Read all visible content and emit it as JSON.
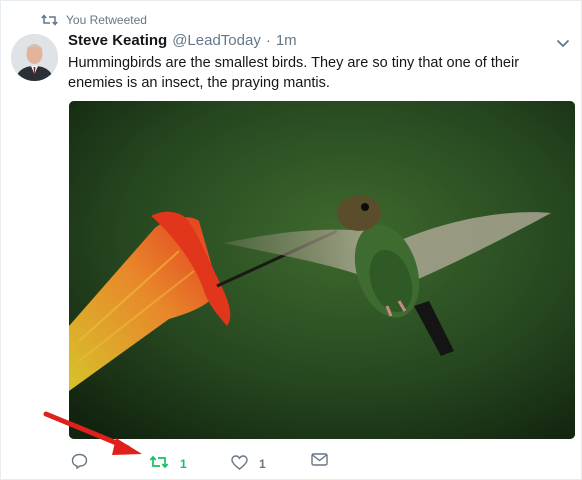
{
  "retweet_context": {
    "text": "You Retweeted",
    "icon": "retweet-icon"
  },
  "author": {
    "name": "Steve Keating",
    "handle": "@LeadToday",
    "separator": "·",
    "time": "1m"
  },
  "tweet": {
    "line1": "Hummingbirds are the smallest birds.  They are so tiny that one of their",
    "line2": "enemies is an insect, the praying mantis."
  },
  "actions": {
    "reply": {
      "icon": "reply-icon"
    },
    "retweet": {
      "icon": "retweet-icon",
      "count": "1",
      "color": "#17bf63"
    },
    "like": {
      "icon": "heart-icon",
      "count": "1"
    },
    "dm": {
      "icon": "envelope-icon"
    }
  },
  "colors": {
    "muted": "#657786",
    "text": "#14171a",
    "retweeted": "#17bf63",
    "annotation_arrow": "#e0201b"
  }
}
